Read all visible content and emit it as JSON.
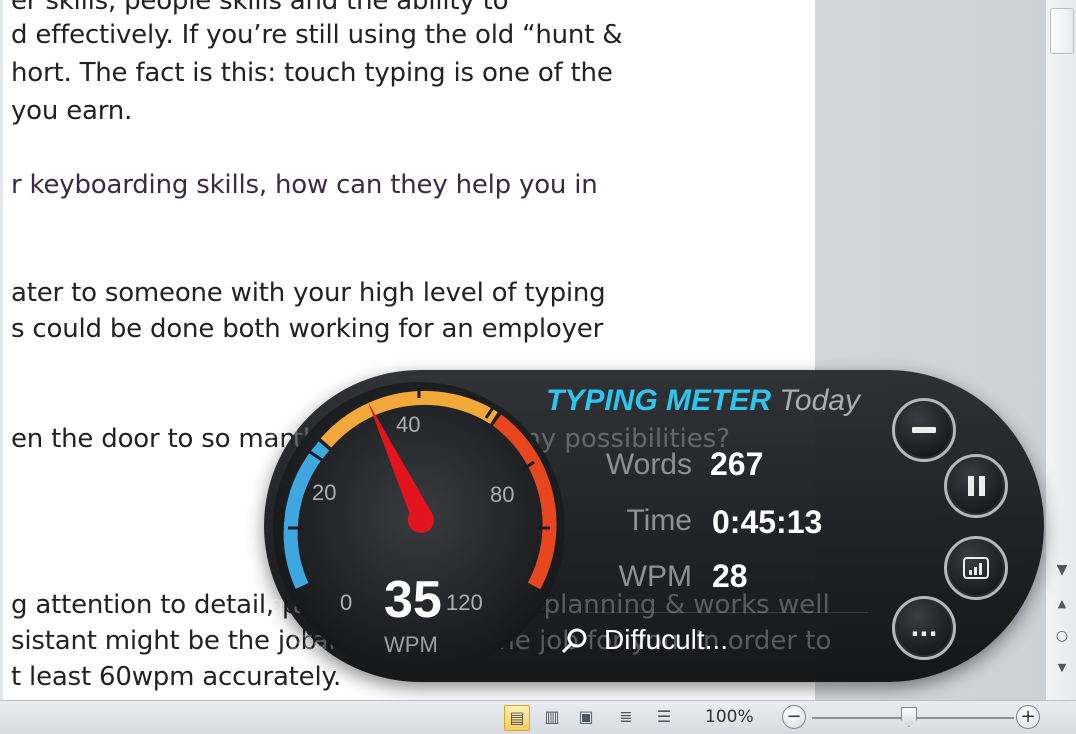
{
  "document": {
    "lines": [
      "er skills, people skills and the ability to",
      "d effectively.  If you’re still using the old “hunt &",
      "hort.  The fact is this: touch typing is one of the",
      "you earn.",
      "r keyboarding skills, how can they help you in",
      "ater to someone with your high level of typing",
      "s could be done both working for an employer",
      "en the door to so many possibilities?",
      "g attention to detail, planning & works well",
      "sistant might be the job for you. In order to",
      "t least 60wpm accurately."
    ]
  },
  "typing_meter": {
    "brand": "TYPING METER",
    "period": "Today",
    "stats": [
      {
        "label": "Words",
        "value": "267"
      },
      {
        "label": "Time",
        "value": "0:45:13"
      },
      {
        "label": "WPM",
        "value": "28"
      }
    ],
    "gauge": {
      "current_wpm": "35",
      "unit": "WPM",
      "ticks": [
        "0",
        "20",
        "40",
        "80",
        "120"
      ],
      "needle_value": 35
    },
    "difficulty_text": "Diffucult...",
    "buttons": {
      "minimize": "–",
      "pause": "❚❚",
      "stats": "stats-icon",
      "more": "..."
    },
    "colors": {
      "brand": "#2ec6ee",
      "arc_low": "#3fa7e0",
      "arc_mid": "#f2a93a",
      "arc_high": "#e8461f",
      "needle": "#e4141f"
    }
  },
  "statusbar": {
    "zoom": "100%",
    "zoom_out": "−",
    "zoom_in": "+",
    "zoom_slider_value": 100
  },
  "scrollbar": {
    "down_arrow": "▼",
    "prev_page": "▲",
    "browse_object": "○",
    "next_page": "▼"
  }
}
